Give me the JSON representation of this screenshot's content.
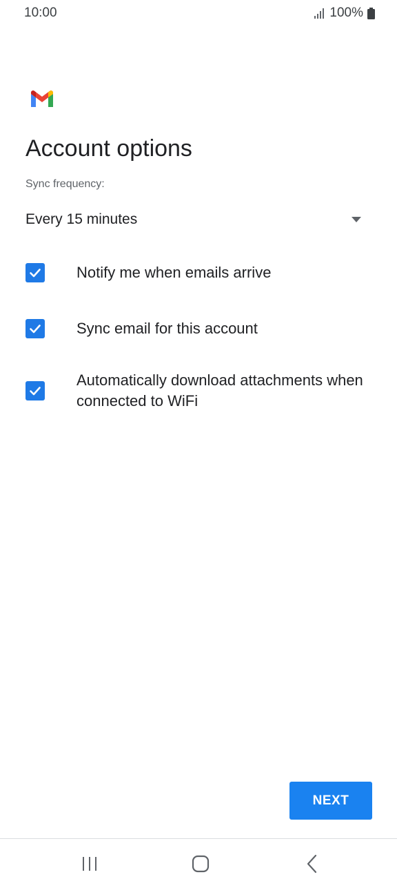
{
  "status_bar": {
    "time": "10:00",
    "battery": "100%"
  },
  "icons": {
    "signal": "signal-icon",
    "battery": "battery-icon",
    "logo": "gmail-logo-icon",
    "dropdown": "dropdown-arrow-icon",
    "check": "check-icon",
    "recent_apps": "recent-apps-icon",
    "home": "home-icon",
    "back": "back-icon"
  },
  "colors": {
    "accent": "#1a82f0",
    "checkbox": "#1f7ae6",
    "gmail_red": "#ea4335",
    "gmail_blue": "#4285f4",
    "gmail_green": "#34a853",
    "gmail_yellow": "#fbbc04"
  },
  "page": {
    "title": "Account options",
    "sync_label": "Sync frequency:",
    "sync_value": "Every 15 minutes"
  },
  "options": [
    {
      "label": "Notify me when emails arrive",
      "checked": true
    },
    {
      "label": "Sync email for this account",
      "checked": true
    },
    {
      "label": "Automatically download attachments when connected to WiFi",
      "checked": true
    }
  ],
  "actions": {
    "next_label": "NEXT"
  }
}
